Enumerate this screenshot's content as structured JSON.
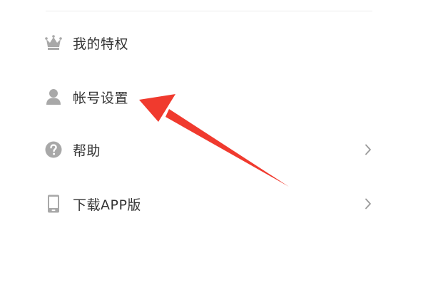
{
  "menu": {
    "items": [
      {
        "label": "我的特权",
        "icon": "crown-icon",
        "has_chevron": false
      },
      {
        "label": "帐号设置",
        "icon": "user-icon",
        "has_chevron": false
      },
      {
        "label": "帮助",
        "icon": "help-icon",
        "has_chevron": true
      },
      {
        "label": "下载APP版",
        "icon": "phone-icon",
        "has_chevron": true
      }
    ]
  },
  "colors": {
    "icon_gray": "#a8a8a8",
    "text": "#333333",
    "chevron": "#9a9a9a",
    "annotation_arrow": "#f03a2e"
  }
}
